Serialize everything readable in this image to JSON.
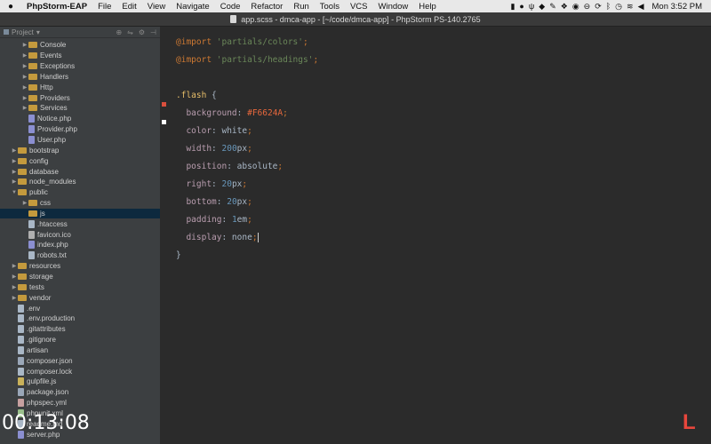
{
  "menubar": {
    "apple": "",
    "items": [
      "PhpStorm-EAP",
      "File",
      "Edit",
      "View",
      "Navigate",
      "Code",
      "Refactor",
      "Run",
      "Tools",
      "VCS",
      "Window",
      "Help"
    ],
    "status_icons": [
      "clipboard-icon",
      "circle-icon",
      "usb-icon",
      "bluetooth-icon",
      "wrench-icon",
      "dropbox-icon",
      "record-icon",
      "stop-icon",
      "sync-icon",
      "bluetooth-b-icon",
      "timemachine-icon",
      "wifi-icon",
      "volume-icon"
    ],
    "clock": "Mon 3:52 PM"
  },
  "titlebar": {
    "title": "app.scss - dmca-app - [~/code/dmca-app] - PhpStorm PS-140.2765"
  },
  "project": {
    "header_label": "Project",
    "tree": [
      {
        "label": "Console",
        "type": "folder",
        "depth": 2,
        "arrow": true
      },
      {
        "label": "Events",
        "type": "folder",
        "depth": 2,
        "arrow": true
      },
      {
        "label": "Exceptions",
        "type": "folder",
        "depth": 2,
        "arrow": true
      },
      {
        "label": "Handlers",
        "type": "folder",
        "depth": 2,
        "arrow": true
      },
      {
        "label": "Http",
        "type": "folder",
        "depth": 2,
        "arrow": true
      },
      {
        "label": "Providers",
        "type": "folder",
        "depth": 2,
        "arrow": true
      },
      {
        "label": "Services",
        "type": "folder",
        "depth": 2,
        "arrow": true
      },
      {
        "label": "Notice.php",
        "type": "php",
        "depth": 2,
        "arrow": false
      },
      {
        "label": "Provider.php",
        "type": "php",
        "depth": 2,
        "arrow": false
      },
      {
        "label": "User.php",
        "type": "php",
        "depth": 2,
        "arrow": false
      },
      {
        "label": "bootstrap",
        "type": "folder",
        "depth": 1,
        "arrow": true
      },
      {
        "label": "config",
        "type": "folder",
        "depth": 1,
        "arrow": true
      },
      {
        "label": "database",
        "type": "folder",
        "depth": 1,
        "arrow": true
      },
      {
        "label": "node_modules",
        "type": "folder",
        "depth": 1,
        "arrow": true
      },
      {
        "label": "public",
        "type": "folder",
        "depth": 1,
        "arrow": true,
        "open": true
      },
      {
        "label": "css",
        "type": "folder",
        "depth": 2,
        "arrow": true
      },
      {
        "label": "js",
        "type": "folder",
        "depth": 2,
        "arrow": false,
        "selected": true
      },
      {
        "label": ".htaccess",
        "type": "gen",
        "depth": 2,
        "arrow": false
      },
      {
        "label": "favicon.ico",
        "type": "ico",
        "depth": 2,
        "arrow": false
      },
      {
        "label": "index.php",
        "type": "php",
        "depth": 2,
        "arrow": false
      },
      {
        "label": "robots.txt",
        "type": "gen",
        "depth": 2,
        "arrow": false
      },
      {
        "label": "resources",
        "type": "folder",
        "depth": 1,
        "arrow": true
      },
      {
        "label": "storage",
        "type": "folder",
        "depth": 1,
        "arrow": true
      },
      {
        "label": "tests",
        "type": "folder",
        "depth": 1,
        "arrow": true
      },
      {
        "label": "vendor",
        "type": "folder",
        "depth": 1,
        "arrow": true
      },
      {
        "label": ".env",
        "type": "gen",
        "depth": 1,
        "arrow": false
      },
      {
        "label": ".env.production",
        "type": "gen",
        "depth": 1,
        "arrow": false
      },
      {
        "label": ".gitattributes",
        "type": "gen",
        "depth": 1,
        "arrow": false
      },
      {
        "label": ".gitignore",
        "type": "gen",
        "depth": 1,
        "arrow": false
      },
      {
        "label": "artisan",
        "type": "gen",
        "depth": 1,
        "arrow": false
      },
      {
        "label": "composer.json",
        "type": "json",
        "depth": 1,
        "arrow": false
      },
      {
        "label": "composer.lock",
        "type": "gen",
        "depth": 1,
        "arrow": false
      },
      {
        "label": "gulpfile.js",
        "type": "js",
        "depth": 1,
        "arrow": false
      },
      {
        "label": "package.json",
        "type": "json",
        "depth": 1,
        "arrow": false
      },
      {
        "label": "phpspec.yml",
        "type": "yml",
        "depth": 1,
        "arrow": false
      },
      {
        "label": "phpunit.xml",
        "type": "xml",
        "depth": 1,
        "arrow": false
      },
      {
        "label": "readme.md",
        "type": "gen",
        "depth": 1,
        "arrow": false
      },
      {
        "label": "server.php",
        "type": "php",
        "depth": 1,
        "arrow": false
      }
    ]
  },
  "editor": {
    "lines": [
      [
        [
          "kw",
          "@import "
        ],
        [
          "str",
          "'partials/colors'"
        ],
        [
          "punc",
          ";"
        ]
      ],
      [
        [
          "kw",
          "@import "
        ],
        [
          "str",
          "'partials/headings'"
        ],
        [
          "punc",
          ";"
        ]
      ],
      [],
      [
        [
          "sel-c",
          ".flash"
        ],
        [
          "plain",
          " {"
        ]
      ],
      [
        [
          "prop",
          "  background"
        ],
        [
          "plain",
          ": "
        ],
        [
          "hex",
          "#F6624A"
        ],
        [
          "punc",
          ";"
        ]
      ],
      [
        [
          "prop",
          "  color"
        ],
        [
          "plain",
          ": white"
        ],
        [
          "punc",
          ";"
        ]
      ],
      [
        [
          "prop",
          "  width"
        ],
        [
          "plain",
          ": "
        ],
        [
          "num",
          "200"
        ],
        [
          "plain",
          "px"
        ],
        [
          "punc",
          ";"
        ]
      ],
      [
        [
          "prop",
          "  position"
        ],
        [
          "plain",
          ": absolute"
        ],
        [
          "punc",
          ";"
        ]
      ],
      [
        [
          "prop",
          "  right"
        ],
        [
          "plain",
          ": "
        ],
        [
          "num",
          "20"
        ],
        [
          "plain",
          "px"
        ],
        [
          "punc",
          ";"
        ]
      ],
      [
        [
          "prop",
          "  bottom"
        ],
        [
          "plain",
          ": "
        ],
        [
          "num",
          "20"
        ],
        [
          "plain",
          "px"
        ],
        [
          "punc",
          ";"
        ]
      ],
      [
        [
          "prop",
          "  padding"
        ],
        [
          "plain",
          ": "
        ],
        [
          "num",
          "1"
        ],
        [
          "plain",
          "em"
        ],
        [
          "punc",
          ";"
        ]
      ],
      [
        [
          "prop",
          "  display"
        ],
        [
          "plain",
          ": none"
        ],
        [
          "punc",
          ";"
        ]
      ],
      [
        [
          "plain",
          "}"
        ]
      ]
    ]
  },
  "timer": "00:13:08",
  "brand": "L"
}
